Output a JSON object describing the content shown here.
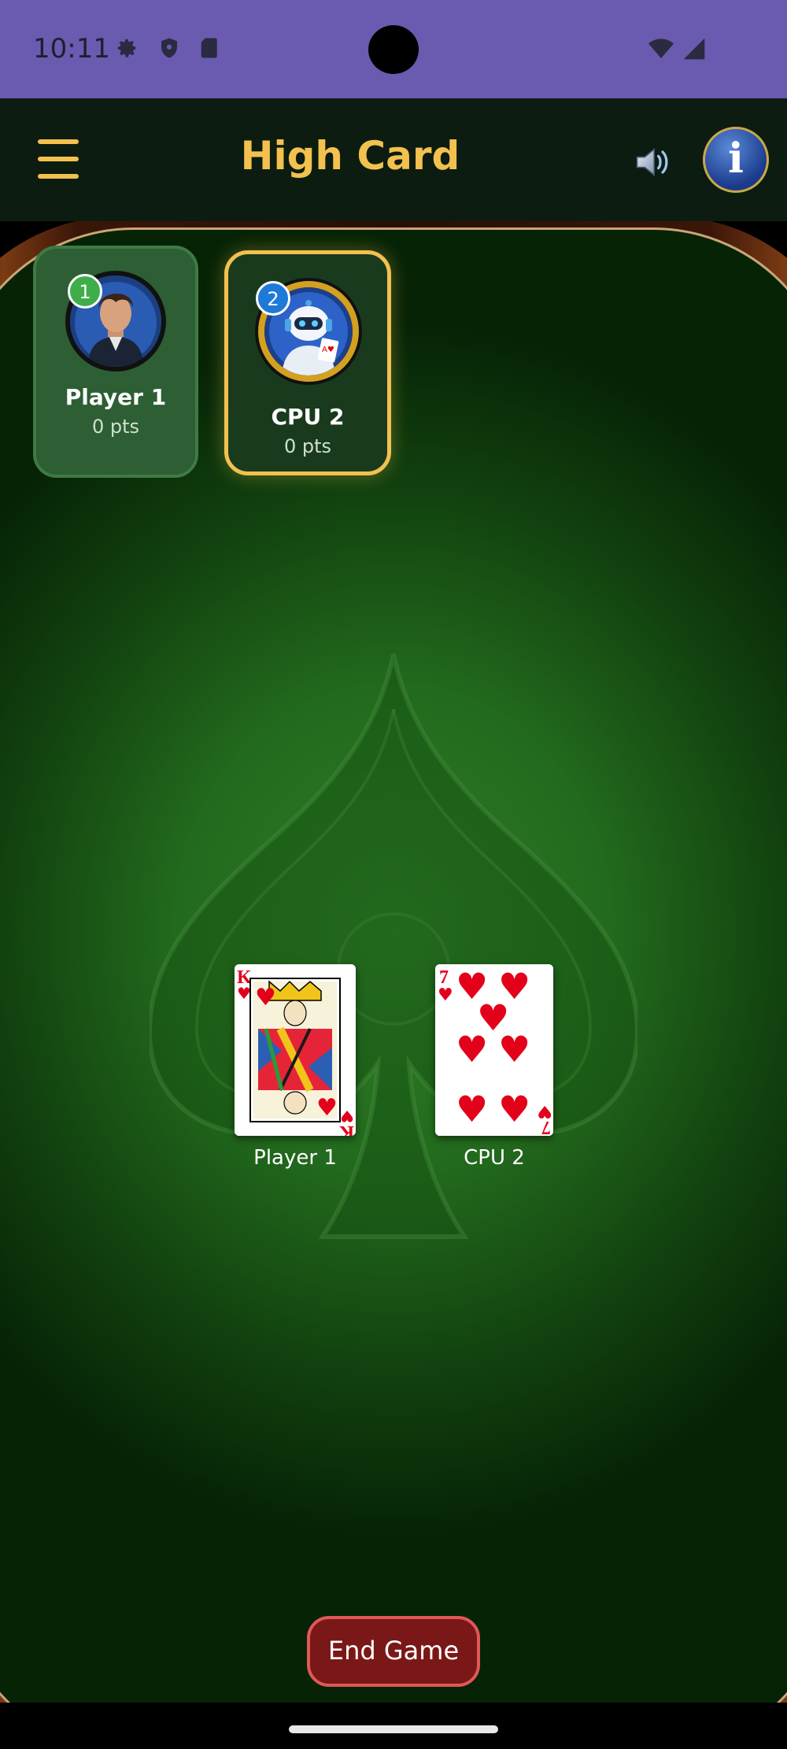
{
  "status_bar": {
    "time": "10:11",
    "icons": [
      "gear-icon",
      "shield-icon",
      "sd-card-icon"
    ],
    "right_icons": [
      "wifi-icon",
      "signal-icon"
    ]
  },
  "app_bar": {
    "title": "High Card",
    "menu_icon": "hamburger-menu-icon",
    "sound_icon": "speaker-icon",
    "info_label": "i"
  },
  "players": [
    {
      "seat": "1",
      "name": "Player 1",
      "points": "0 pts",
      "active": false
    },
    {
      "seat": "2",
      "name": "CPU 2",
      "points": "0 pts",
      "active": true
    }
  ],
  "table": {
    "cards": [
      {
        "owner": "Player 1",
        "rank": "K",
        "suit": "hearts",
        "suit_symbol": "♥"
      },
      {
        "owner": "CPU 2",
        "rank": "7",
        "suit": "hearts",
        "suit_symbol": "♥"
      }
    ]
  },
  "actions": {
    "end_game_label": "End Game"
  },
  "colors": {
    "accent_gold": "#f2c14e",
    "status_bar": "#6a5ab0",
    "end_game": "#7a1818",
    "card_red": "#e3001b"
  }
}
